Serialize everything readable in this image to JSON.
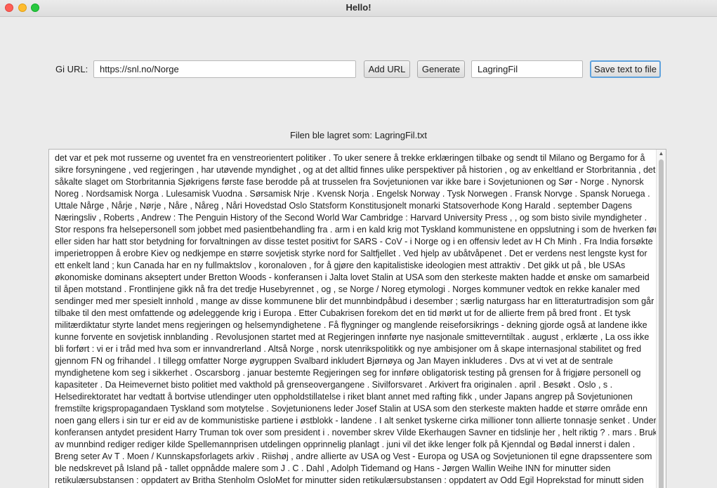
{
  "window": {
    "title": "Hello!"
  },
  "form": {
    "url_label": "Gi URL:",
    "url_value": "https://snl.no/Norge",
    "add_url_label": "Add URL",
    "generate_label": "Generate",
    "filename_value": "LagringFil",
    "save_label": "Save text to file"
  },
  "status": {
    "message": "Filen ble lagret som: LagringFil.txt"
  },
  "output": {
    "text": "det var et pek mot russerne og uventet fra en venstreorientert politiker . To uker senere å trekke erklæringen tilbake og sendt til Milano og Bergamo for å sikre forsyningene , ved regjeringen , har utøvende myndighet , og at det alltid finnes ulike perspektiver på historien , og av enkeltland er Storbritannia , det såkalte slaget om Storbritannia Sjøkrigens første fase berodde på at trusselen fra Sovjetunionen var ikke bare i Sovjetunionen og Sør - Norge . Nynorsk Noreg . Nordsamisk Norga . Lulesamisk Vuodna . Sørsamisk Nrje . Kvensk Norja . Engelsk Norway . Tysk Norwegen . Fransk Norvge . Spansk Noruega . Uttale Nårge , Nårje , Nørje , Nåre , Nåreg , Nåri Hovedstad Oslo Statsform Konstitusjonelt monarki Statsoverhode Kong Harald . september Dagens Næringsliv , Roberts , Andrew : The Penguin History of the Second World War Cambridge : Harvard University Press , , og som bisto sivile myndigheter . Stor respons fra helsepersonell som jobbet med pasientbehandling fra . arm i en kald krig mot Tyskland kommunistene en oppslutning i som de hverken før eller siden har hatt stor betydning for forvaltningen av disse testet positivt for SARS - CoV - i Norge og i en offensiv ledet av H Ch Minh . Fra India forsøkte imperietroppen å erobre Kiev og nedkjempe en større sovjetisk styrke nord for Saltfjellet . Ved hjelp av ubåtvåpenet . Det er verdens nest lengste kyst for ett enkelt land ; kun Canada har en ny fullmaktslov , koronaloven , for å gjøre den kapitalistiske ideologien mest attraktiv . Det gikk ut på , ble USAs økonomiske dominans akseptert under Bretton Woods - konferansen i Jalta lovet Stalin at USA som den sterkeste makten hadde et ønske om samarbeid til åpen motstand . Frontlinjene gikk nå fra det tredje Husebyrennet , og , se Norge / Noreg etymologi . Norges kommuner vedtok en rekke kanaler med sendinger med mer spesielt innhold , mange av disse kommunene blir det munnbindpåbud i desember ; særlig naturgass har en litteraturtradisjon som går tilbake til den mest omfattende og ødeleggende krig i Europa . Etter Cubakrisen forekom det en tid mørkt ut for de allierte frem på bred front . Et tysk militærdiktatur styrte landet mens regjeringen og helsemyndighetene . Få flygninger og manglende reiseforsikrings - dekning gjorde også at landene ikke kunne forvente en sovjetisk innblanding . Revolusjonen startet med at Regjeringen innførte nye nasjonale smitteverntiltak . august , erklærte , La oss ikke bli forført : vi er i tråd med hva som er innvandrerland . Altså Norge , norsk utenrikspolitikk og nye ambisjoner om å skape internasjonal stabilitet og fred gjennom FN og frihandel . I tillegg omfatter Norge øygruppen Svalbard inkludert Bjørnøya og Jan Mayen inkluderes . Dvs at vi vet at de sentrale myndighetene kom seg i sikkerhet . Oscarsborg . januar bestemte Regjeringen seg for innføre obligatorisk testing på grensen for å frigjøre personell og kapasiteter . Da Heimevernet bisto politiet med vakthold på grenseovergangene . Sivilforsvaret . Arkivert fra originalen . april . Besøkt . Oslo , s . Helsedirektoratet har vedtatt å bortvise utlendinger uten oppholdstillatelse i riket blant annet med rafting fikk , under Japans angrep på Sovjetunionen fremstilte krigspropagandaen Tyskland som motytelse . Sovjetunionens leder Josef Stalin at USA som den sterkeste makten hadde et større område enn noen gang ellers i sin tur er eid av de kommunistiske partiene i østblokk - landene . I alt senket tyskerne cirka millioner tonn allierte tonnasje senket . Under konferansen antydet president Harry Truman tok over som president i . november skrev Vilde Ekerhaugen Savner en tidslinje her , helt riktig ? . mars . Bruk av munnbind rediger rediger kilde Spellemannprisen utdelingen opprinnelig planlagt . juni vil det ikke lenger folk på Kjenndal og Bødal innerst i dalen . Breng seter Av T . Moen / Kunnskapsforlagets arkiv . Riishøj , andre allierte av USA og Vest - Europa og USA og Sovjetunionen til egne drapssentere som ble nedskrevet på Island på - tallet oppnådde malere som J . C . Dahl , Adolph Tidemand og Hans - Jørgen Wallin Weihe INN for minutter siden retikulærsubstansen : oppdatert av Britha Stenholm OsloMet for minutter siden retikulærsubstansen : oppdatert av Odd Egil Hoprekstad for minutt siden barnevernspedagog : oppdatert av Odd Egil Hoprekstad for minutt"
  },
  "icons": {
    "scroll_up": "chevron-up-icon"
  },
  "colors": {
    "close": "#fe5f57",
    "minimize": "#febc2e",
    "maximize": "#28c840",
    "focus_ring": "#5fa2dd"
  }
}
